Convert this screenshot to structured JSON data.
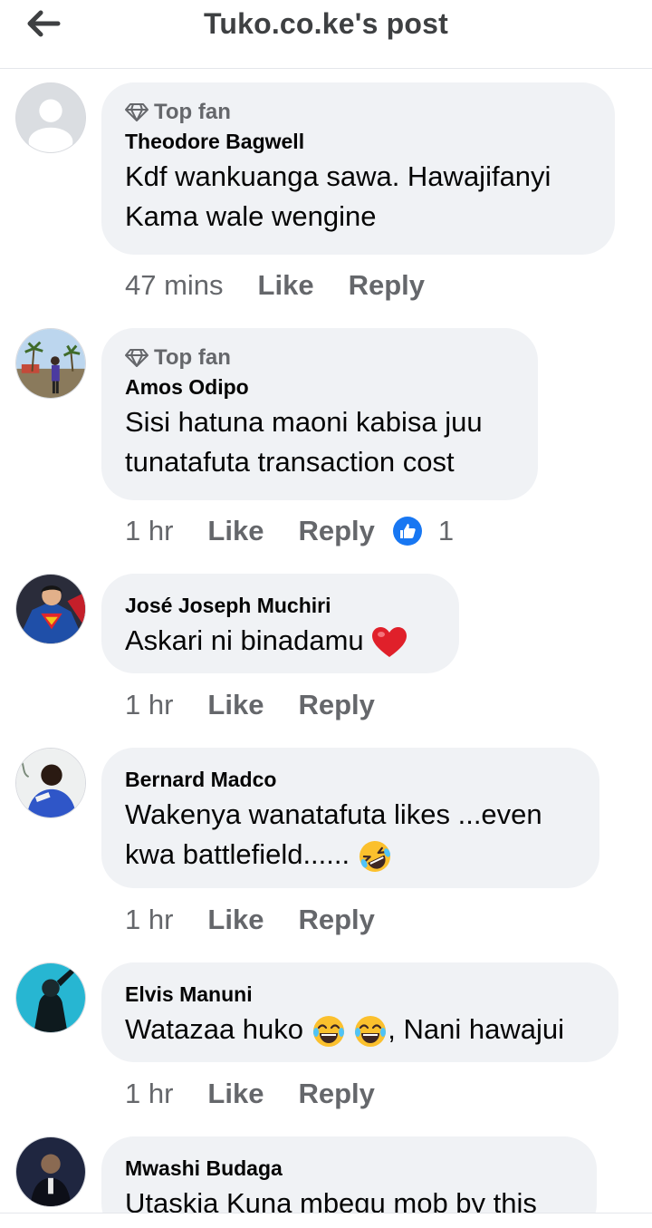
{
  "header": {
    "title": "Tuko.co.ke's post"
  },
  "labels": {
    "top_fan": "Top fan",
    "like": "Like",
    "reply": "Reply"
  },
  "comments": [
    {
      "author": "Theodore Bagwell",
      "top_fan": true,
      "lines": [
        "Kdf wankuanga sawa. Hawajifanyi",
        "Kama wale wengine"
      ],
      "time": "47 mins"
    },
    {
      "author": "Amos Odipo",
      "top_fan": true,
      "lines": [
        "Sisi hatuna maoni kabisa juu",
        "tunatafuta transaction cost"
      ],
      "time": "1 hr",
      "reaction_count": "1"
    },
    {
      "author": "José Joseph Muchiri",
      "top_fan": false,
      "lines": [
        "Askari ni binadamu"
      ],
      "time": "1 hr"
    },
    {
      "author": "Bernard Madco",
      "top_fan": false,
      "lines": [
        "Wakenya wanatafuta likes ...even",
        "kwa battlefield......"
      ],
      "time": "1 hr"
    },
    {
      "author": "Elvis Manuni",
      "top_fan": false,
      "lines": [
        "Watazaa huko",
        ", Nani hawajui"
      ],
      "time": "1 hr"
    },
    {
      "author": "Mwashi Budaga",
      "top_fan": false,
      "lines": [
        "Utaskia Kuna mbegu mob by this"
      ]
    }
  ],
  "icons": {
    "back": "arrow-left-icon",
    "top_fan_badge": "diamond-icon",
    "like_reaction": "thumbs-up-icon"
  },
  "colors": {
    "bubble": "#f0f2f5",
    "meta": "#65676b",
    "reaction": "#1877f2"
  }
}
